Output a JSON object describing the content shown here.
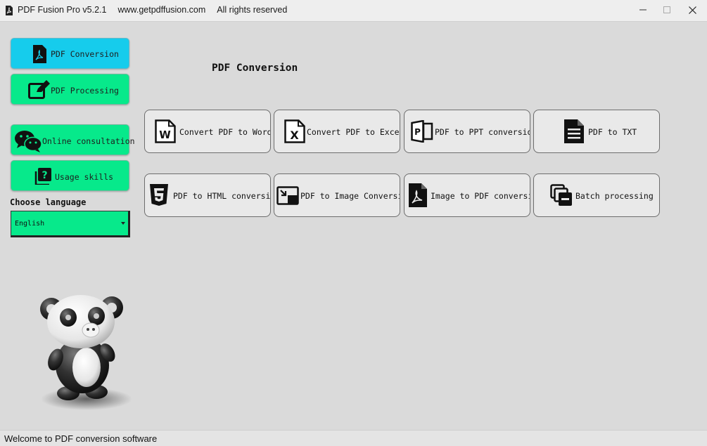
{
  "window": {
    "title": "PDF Fusion Pro v5.2.1",
    "website": "www.getpdffusion.com",
    "rights": "All rights reserved",
    "controls": [
      "minimize-icon",
      "maximize-icon",
      "close-icon"
    ]
  },
  "sidebar": {
    "items": [
      {
        "label": "PDF Conversion",
        "icon": "pdf-file-icon",
        "active": true
      },
      {
        "label": "PDF Processing",
        "icon": "edit-icon",
        "active": false
      },
      {
        "label": "Online consultation",
        "icon": "wechat-icon",
        "active": false
      },
      {
        "label": "Usage skills",
        "icon": "help-icon",
        "active": false
      }
    ],
    "language_label": "Choose language",
    "language_value": "English",
    "mascot": "panda-mascot"
  },
  "main": {
    "title": "PDF Conversion",
    "buttons": [
      {
        "label": "Convert PDF to Word",
        "icon": "word-file-icon"
      },
      {
        "label": "Convert PDF to Excel",
        "icon": "excel-file-icon"
      },
      {
        "label": "PDF to PPT conversion",
        "icon": "ppt-file-icon"
      },
      {
        "label": "PDF to TXT",
        "icon": "text-file-icon"
      },
      {
        "label": "PDF to HTML conversion",
        "icon": "html5-icon"
      },
      {
        "label": "PDF to Image Conversion",
        "icon": "image-convert-icon"
      },
      {
        "label": "Image to PDF conversion",
        "icon": "pdf-file-icon"
      },
      {
        "label": "Batch processing",
        "icon": "batch-icon"
      }
    ]
  },
  "status": {
    "message": "Welcome to PDF conversion software"
  },
  "colors": {
    "active": "#16ccec",
    "accent": "#07e98b",
    "background": "#dadada"
  }
}
